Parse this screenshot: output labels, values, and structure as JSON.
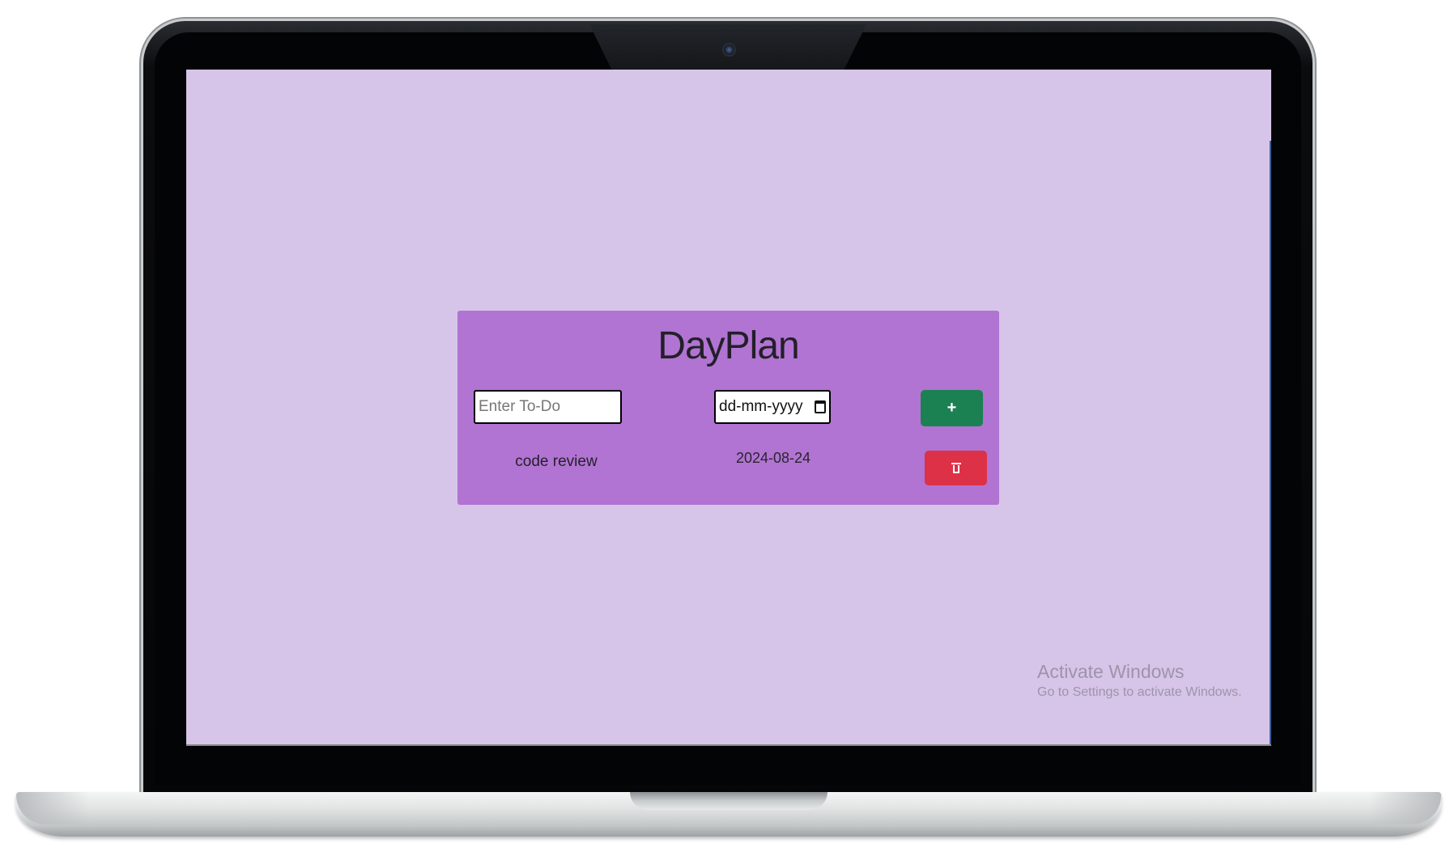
{
  "app": {
    "title": "DayPlan"
  },
  "form": {
    "todo_placeholder": "Enter To-Do",
    "todo_value": "",
    "date_placeholder": "dd-mm-yyyy",
    "add_label": "+"
  },
  "todos": [
    {
      "name": "code review",
      "date": "2024-08-24"
    }
  ],
  "watermark": {
    "title": "Activate Windows",
    "subtitle": "Go to Settings to activate Windows."
  },
  "icons": {
    "calendar": "calendar-icon",
    "delete": "trash-icon"
  },
  "colors": {
    "page_background": "#d6c5e8",
    "card_background": "#b174d2",
    "add_button": "#1c8152",
    "delete_button": "#dd3147"
  }
}
